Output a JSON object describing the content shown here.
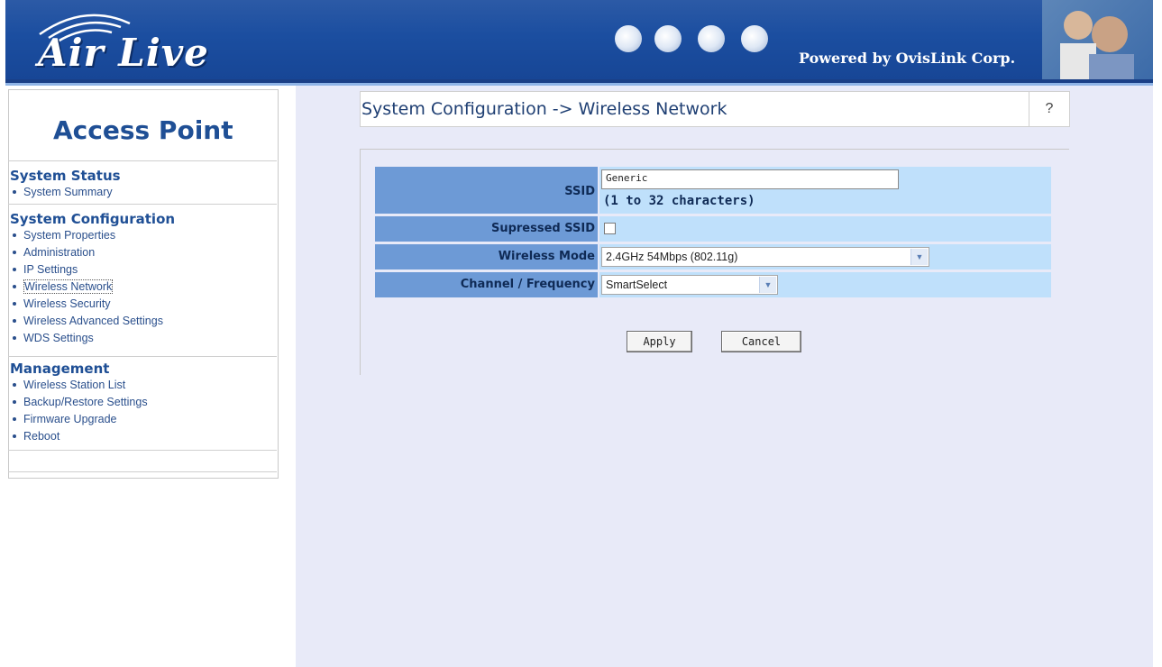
{
  "header": {
    "logo_text": "Air Live",
    "powered_by": "Powered by OvisLink Corp."
  },
  "sidebar": {
    "title": "Access Point",
    "sections": [
      {
        "heading": "System Status",
        "items": [
          "System Summary"
        ]
      },
      {
        "heading": "System Configuration",
        "items": [
          "System Properties",
          "Administration",
          "IP Settings",
          "Wireless Network",
          "Wireless Security",
          "Wireless Advanced Settings",
          "WDS Settings"
        ]
      },
      {
        "heading": "Management",
        "items": [
          "Wireless Station List",
          "Backup/Restore Settings",
          "Firmware Upgrade",
          "Reboot"
        ]
      }
    ],
    "active_item": "Wireless Network"
  },
  "main": {
    "page_title": "System Configuration -> Wireless Network",
    "help_label": "?",
    "form": {
      "ssid_label": "SSID",
      "ssid_value": "Generic",
      "ssid_hint": "(1 to 32 characters)",
      "suppressed_ssid_label": "Supressed SSID",
      "suppressed_ssid_checked": false,
      "wireless_mode_label": "Wireless Mode",
      "wireless_mode_value": "2.4GHz 54Mbps (802.11g)",
      "channel_label": "Channel / Frequency",
      "channel_value": "SmartSelect"
    },
    "apply_label": "Apply",
    "cancel_label": "Cancel"
  },
  "colors": {
    "header_blue": "#1b4ea0",
    "label_blue": "#6d9ad6",
    "value_light_blue": "#bfe0fb",
    "main_bg": "#e8eaf8",
    "link_blue": "#2a4f8c"
  }
}
